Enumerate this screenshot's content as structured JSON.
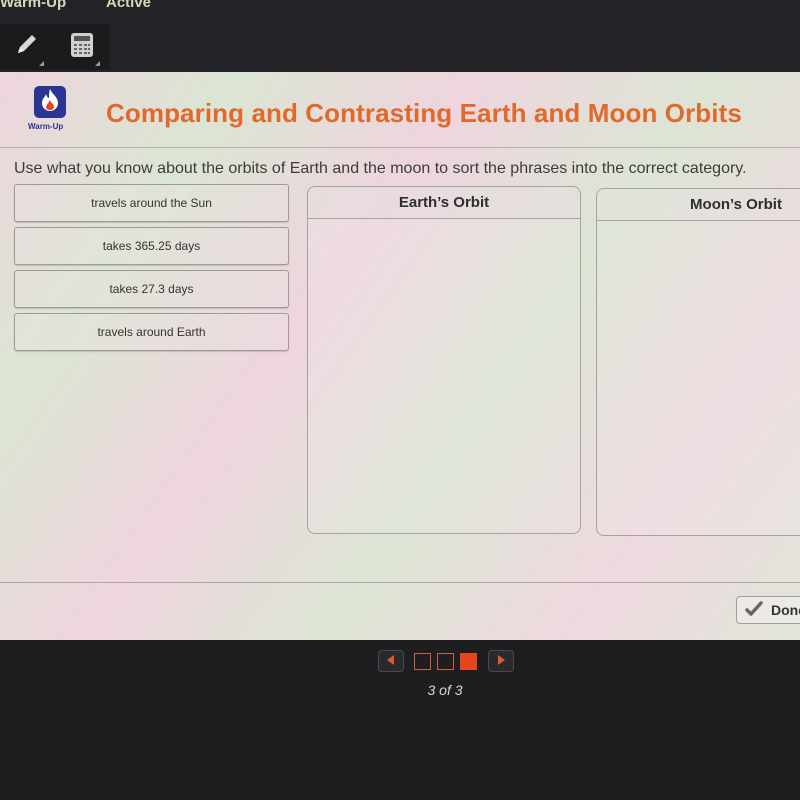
{
  "top_bar": {
    "tabs": [
      {
        "label": "Warm-Up"
      },
      {
        "label": "Active"
      }
    ],
    "tools": [
      {
        "icon": "pencil-icon",
        "label": "Pencil"
      },
      {
        "icon": "calculator-icon",
        "label": "Calculator"
      }
    ]
  },
  "header": {
    "logo_icon": "flame-icon",
    "logo_label": "Warm-Up",
    "title": "Comparing and Contrasting Earth and Moon Orbits"
  },
  "activity": {
    "instructions": "Use what you know about the orbits of Earth and the moon to sort the phrases into the correct category.",
    "tiles": [
      {
        "label": "travels around the Sun"
      },
      {
        "label": "takes 365.25 days"
      },
      {
        "label": "takes 27.3 days"
      },
      {
        "label": "travels around Earth"
      }
    ],
    "categories": [
      {
        "label": "Earth’s Orbit",
        "items": []
      },
      {
        "label": "Moon’s Orbit",
        "items": []
      }
    ],
    "done_button": {
      "label": "Done",
      "icon": "checkmark-icon"
    }
  },
  "pagination": {
    "current": 3,
    "total": 3,
    "label": "3 of 3",
    "accent_color": "#e8441e"
  }
}
